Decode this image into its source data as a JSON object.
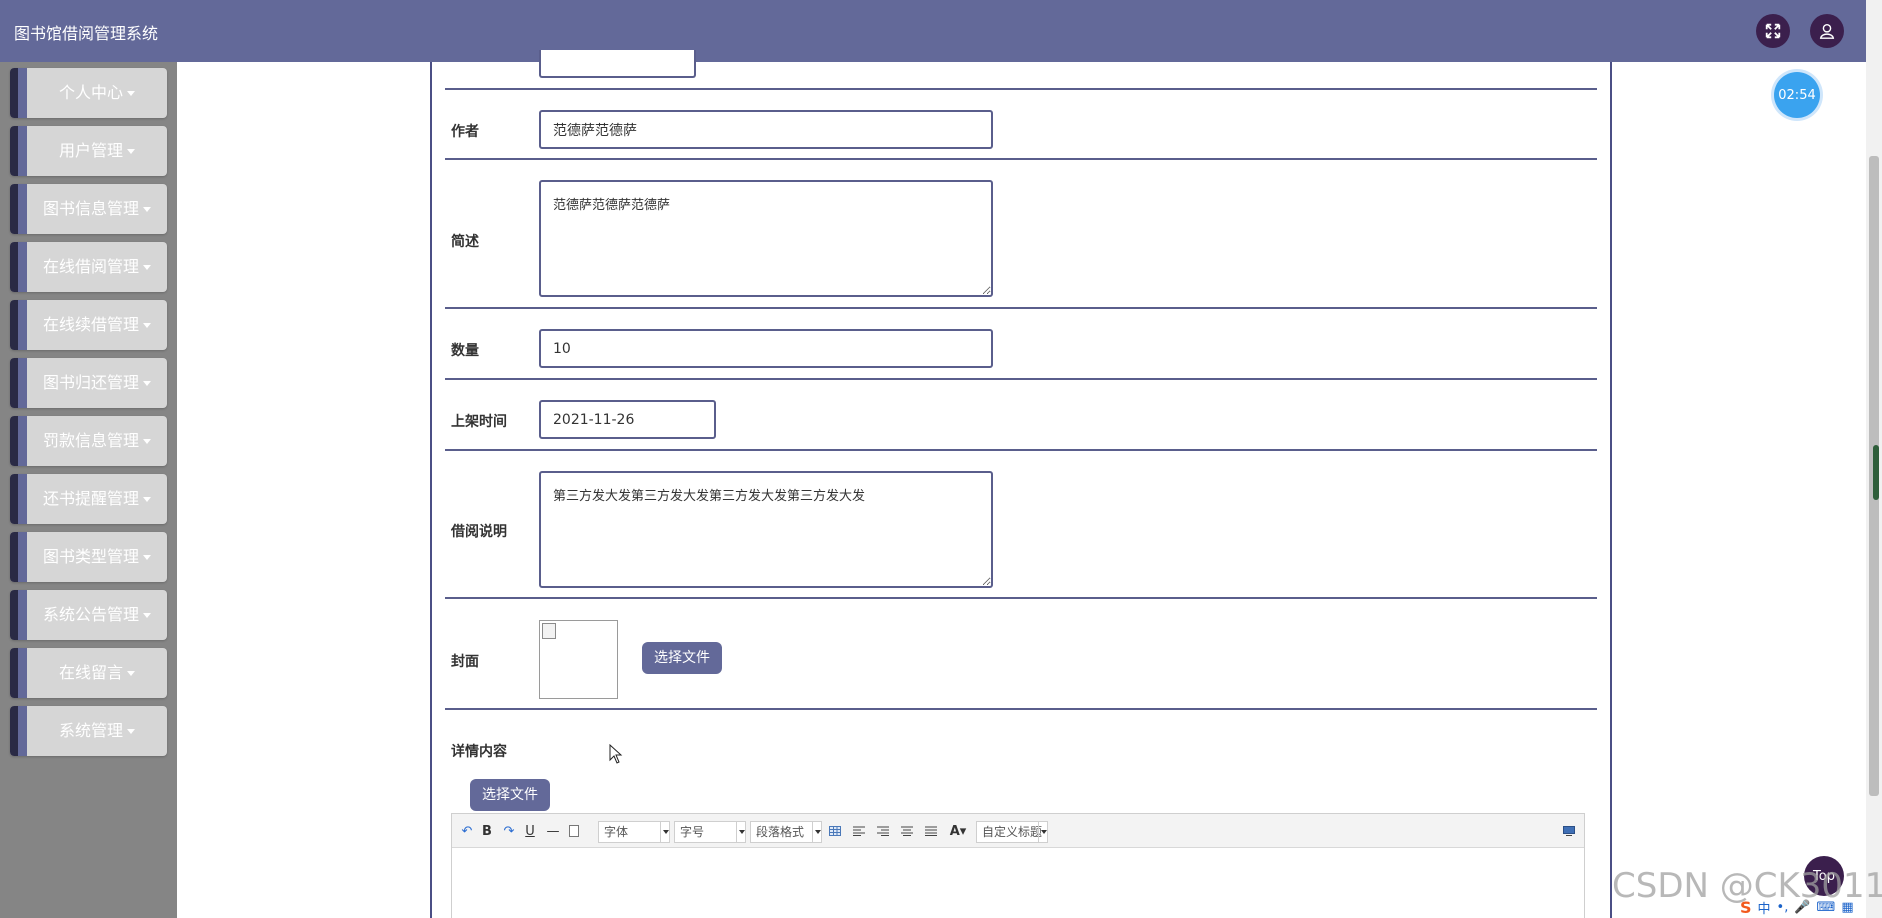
{
  "app": {
    "title": "图书馆借阅管理系统"
  },
  "header": {
    "fullscreen_icon": "expand-icon",
    "user_icon": "user-icon"
  },
  "sidebar": {
    "items": [
      {
        "label": "个人中心"
      },
      {
        "label": "用户管理"
      },
      {
        "label": "图书信息管理"
      },
      {
        "label": "在线借阅管理"
      },
      {
        "label": "在线续借管理"
      },
      {
        "label": "图书归还管理"
      },
      {
        "label": "罚款信息管理"
      },
      {
        "label": "还书提醒管理"
      },
      {
        "label": "图书类型管理"
      },
      {
        "label": "系统公告管理"
      },
      {
        "label": "在线留言"
      },
      {
        "label": "系统管理"
      }
    ]
  },
  "timer": {
    "value": "02:54"
  },
  "form": {
    "author": {
      "label": "作者",
      "value": "范德萨范德萨"
    },
    "summary": {
      "label": "简述",
      "value": "范德萨范德萨范德萨"
    },
    "quantity": {
      "label": "数量",
      "value": "10"
    },
    "shelf_date": {
      "label": "上架时间",
      "value": "2021-11-26"
    },
    "borrow_note": {
      "label": "借阅说明",
      "value": "第三方发大发第三方发大发第三方发大发第三方发大发"
    },
    "cover": {
      "label": "封面",
      "button": "选择文件"
    },
    "details": {
      "label": "详情内容",
      "button": "选择文件"
    }
  },
  "editor": {
    "font_select": "字体",
    "size_select": "字号",
    "paragraph_select": "段落格式",
    "custom_title_select": "自定义标题"
  },
  "top_button": {
    "label": "Top"
  },
  "watermark": "CSDN @CK3011",
  "ime": {
    "label": "中"
  }
}
